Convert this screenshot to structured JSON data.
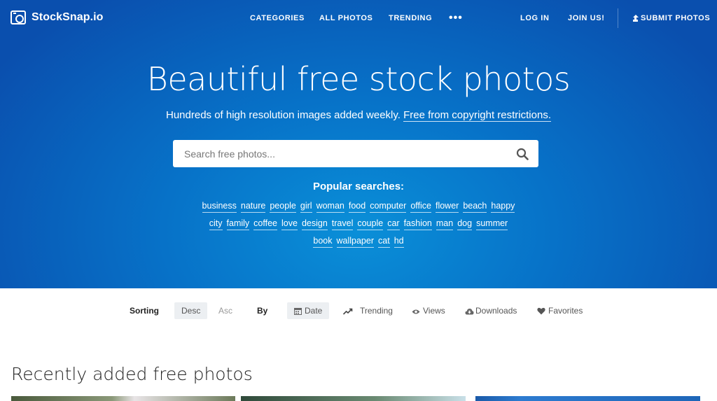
{
  "brand": {
    "name": "StockSnap.io"
  },
  "nav": {
    "categories": "CATEGORIES",
    "all_photos": "ALL PHOTOS",
    "trending": "TRENDING",
    "more": "•••",
    "login": "LOG IN",
    "join": "JOIN US!",
    "submit": "SUBMIT PHOTOS"
  },
  "hero": {
    "headline": "Beautiful free stock photos",
    "sub_text": "Hundreds of high resolution images added weekly.",
    "sub_link": "Free from copyright restrictions."
  },
  "search": {
    "placeholder": "Search free photos..."
  },
  "popular": {
    "title": "Popular searches:",
    "row1": [
      "business",
      "nature",
      "people",
      "girl",
      "woman",
      "food",
      "computer",
      "office",
      "flower",
      "beach",
      "happy"
    ],
    "row2": [
      "city",
      "family",
      "coffee",
      "love",
      "design",
      "travel",
      "couple",
      "car",
      "fashion",
      "man",
      "dog",
      "summer"
    ],
    "row3": [
      "book",
      "wallpaper",
      "cat",
      "hd"
    ]
  },
  "sorting": {
    "label": "Sorting",
    "desc": "Desc",
    "asc": "Asc",
    "by_label": "By",
    "date": "Date",
    "trending": "Trending",
    "views": "Views",
    "downloads": "Downloads",
    "favorites": "Favorites"
  },
  "section": {
    "title": "Recently added free photos"
  },
  "colors": {
    "hero_dark": "#0a4fae",
    "hero_light": "#0a8fd8",
    "active_bg": "#eceff2"
  }
}
